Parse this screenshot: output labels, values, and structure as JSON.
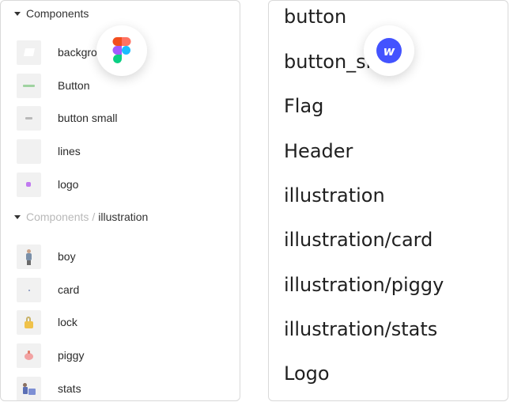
{
  "figma_panel": {
    "section1": {
      "title": "Components"
    },
    "section1_items": [
      {
        "label": "backgro",
        "icon": "background-thumbnail"
      },
      {
        "label": "Button",
        "icon": "button-thumbnail"
      },
      {
        "label": "button small",
        "icon": "button-small-thumbnail"
      },
      {
        "label": "lines",
        "icon": "lines-thumbnail"
      },
      {
        "label": "logo",
        "icon": "logo-thumbnail"
      }
    ],
    "section2": {
      "parent": "Components",
      "separator": "/",
      "child": "illustration"
    },
    "section2_items": [
      {
        "label": "boy",
        "icon": "boy-thumbnail"
      },
      {
        "label": "card",
        "icon": "card-thumbnail"
      },
      {
        "label": "lock",
        "icon": "lock-thumbnail"
      },
      {
        "label": "piggy",
        "icon": "piggy-thumbnail"
      },
      {
        "label": "stats",
        "icon": "stats-thumbnail"
      }
    ]
  },
  "webflow_panel": {
    "items": [
      "button",
      "button_sm",
      "Flag",
      "Header",
      "illustration",
      "illustration/card",
      "illustration/piggy",
      "illustration/stats",
      "Logo"
    ]
  },
  "badges": {
    "figma": {
      "icon": "figma-logo-icon"
    },
    "webflow": {
      "icon": "webflow-logo-icon",
      "letter": "w",
      "color": "#4353ff"
    }
  }
}
